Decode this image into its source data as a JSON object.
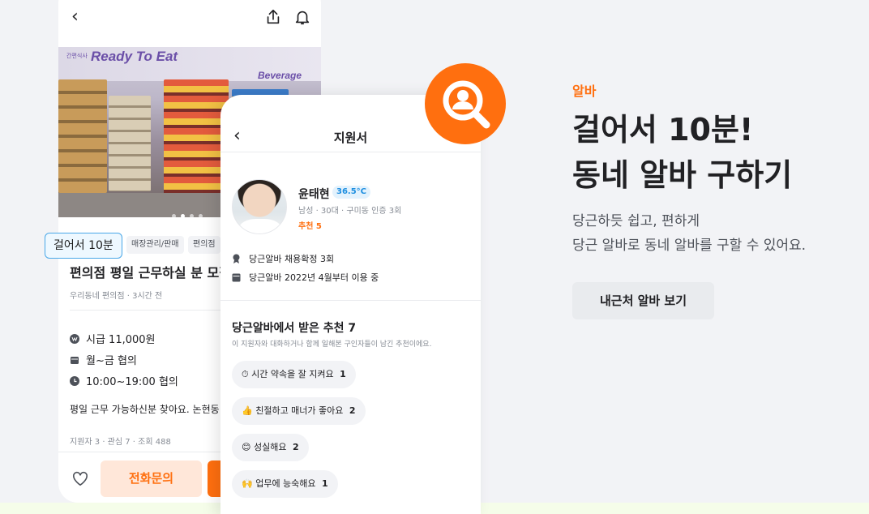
{
  "colors": {
    "brand_orange": "#ff6f0f",
    "temperature_blue": "#1f8fe0",
    "background": "#f2f3f6"
  },
  "job_post": {
    "walk_badge": "걸어서 10분",
    "tags": [
      "매장관리/판매",
      "편의점"
    ],
    "photo_signs": {
      "main": "Ready To Eat",
      "small": "간편식사",
      "secondary": "Beverage"
    },
    "title": "편의점 평일 근무하실 분 모집",
    "store_meta": "우리동네 편의점 · 3시간 전",
    "wage": "시급 11,000원",
    "days": "월~금 협의",
    "hours": "10:00~19:00 협의",
    "description": "평일 근무 가능하신분 찾아요. 논현동",
    "stats": "지원자 3 · 관심 7 · 조회 488",
    "call_button": "전화문의",
    "icons": {
      "back": "chevron-left-icon",
      "share": "share-icon",
      "notify": "bell-icon",
      "like": "heart-icon"
    }
  },
  "application": {
    "title": "지원서",
    "applicant": {
      "name": "윤태현",
      "temperature": "36.5°C",
      "meta": "남성 · 30대 · 구미동 인증 3회",
      "recommend": "추천 5"
    },
    "stats": [
      "당근알바 채용확정 3회",
      "당근알바 2022년 4월부터 이용 중"
    ],
    "recommendations_title": "당근알바에서 받은 추천 7",
    "recommendations_sub": "이 지원자와 대화하거나 함께 일해본 구인자들이 남긴 추천이에요.",
    "chips": [
      {
        "emoji": "⏱",
        "label": "시간 약속을 잘 지켜요",
        "count": "1"
      },
      {
        "emoji": "👍",
        "label": "친절하고 매너가 좋아요",
        "count": "2"
      },
      {
        "emoji": "😊",
        "label": "성실해요",
        "count": "2"
      },
      {
        "emoji": "🙌",
        "label": "업무에 능숙해요",
        "count": "1"
      }
    ]
  },
  "marketing": {
    "eyebrow": "알바",
    "headline_line1": "걸어서 10분!",
    "headline_line2": "동네 알바 구하기",
    "desc_line1": "당근하듯 쉽고, 편하게",
    "desc_line2": "당근 알바로 동네 알바를 구할 수 있어요.",
    "cta_label": "내근처 알바 보기"
  }
}
